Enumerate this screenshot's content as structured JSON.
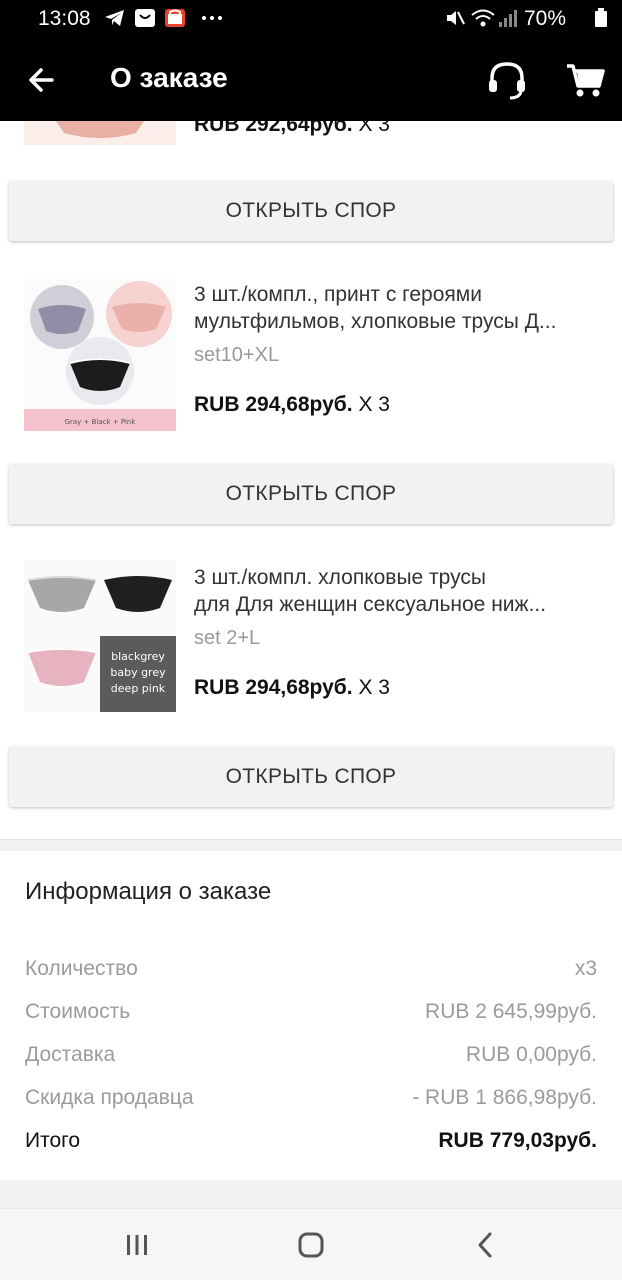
{
  "status_bar": {
    "time": "13:08",
    "battery": "70%"
  },
  "app_bar": {
    "title": "О заказе",
    "icons": [
      "back-arrow-icon",
      "headset-support-icon",
      "shopping-cart-icon"
    ]
  },
  "previous_item": {
    "price_partial": "RUB 292,64руб.",
    "qty_partial": "X 3"
  },
  "items": [
    {
      "title_line1": "3 шт./компл., принт с героями",
      "title_line2": "мультфильмов, хлопковые трусы Д...",
      "sku": "set10+XL",
      "price": "RUB 294,68руб.",
      "qty": "X 3",
      "thumb_caption": "Gray + Black + Pink"
    },
    {
      "title_line1": "3 шт./компл. хлопковые трусы",
      "title_line2": "для Для женщин сексуальное ниж...",
      "sku": "set 2+L",
      "price": "RUB 294,68руб.",
      "qty": "X 3",
      "thumb_caption_lines": [
        "blackgrey",
        "baby grey",
        "deep pink"
      ]
    }
  ],
  "dispute_button_label": "ОТКРЫТЬ СПОР",
  "order_info": {
    "title": "Информация о заказе",
    "rows": [
      {
        "label": "Количество",
        "value": "x3"
      },
      {
        "label": "Стоимость",
        "value": "RUB 2 645,99руб."
      },
      {
        "label": "Доставка",
        "value": "RUB 0,00руб."
      },
      {
        "label": "Скидка продавца",
        "value": "- RUB 1 866,98руб."
      }
    ],
    "total": {
      "label": "Итого",
      "value": "RUB 779,03руб."
    }
  },
  "colors": {
    "app_bar": "#000000",
    "button_bg": "#f2f2f2",
    "muted_text": "#9b9b9b",
    "pink": "#f3c2c6"
  }
}
